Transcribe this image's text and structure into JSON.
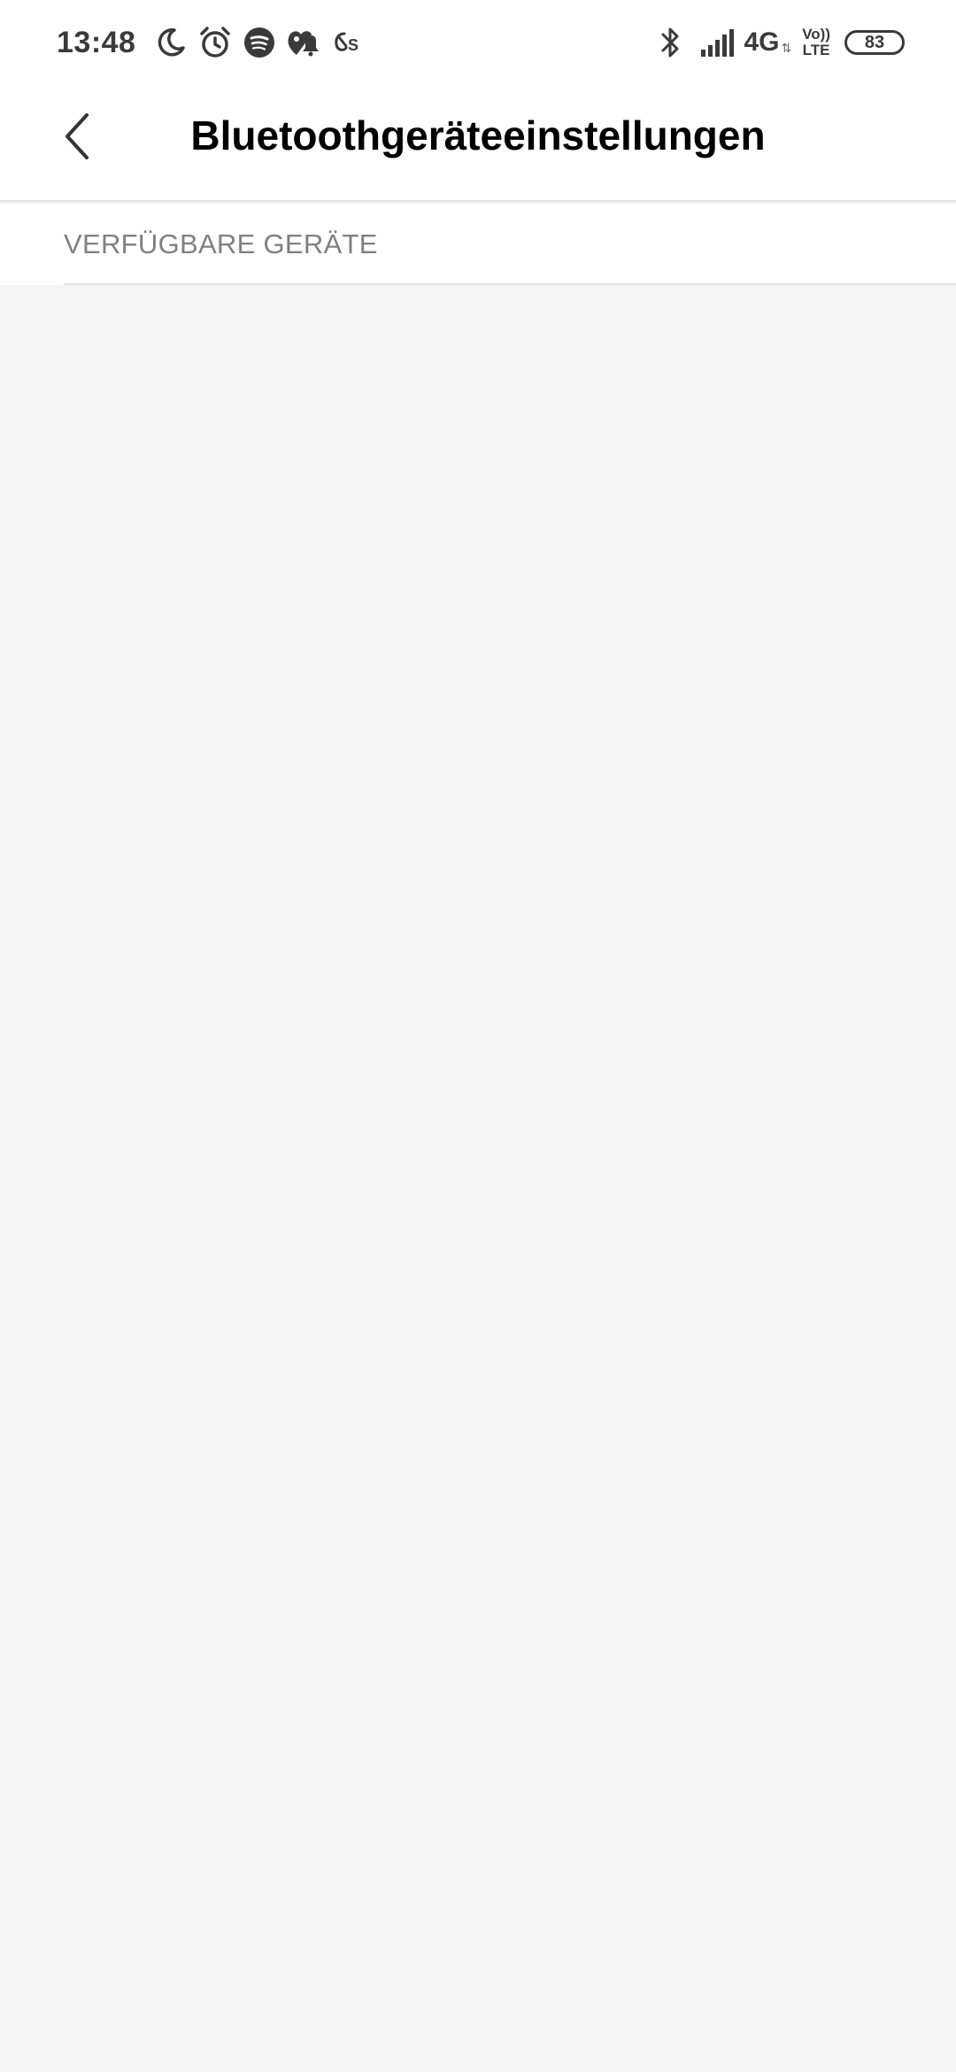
{
  "status_bar": {
    "time": "13:48",
    "network": "4G",
    "network_arrows": "⇅",
    "volte_top": "Vo))",
    "volte_bottom": "LTE",
    "battery": "83",
    "icons": [
      "moon-icon",
      "alarm-icon",
      "spotify-icon",
      "notification-icon",
      "app-icon",
      "bluetooth-icon",
      "signal-icon"
    ]
  },
  "header": {
    "title": "Bluetoothgeräteeinstellungen",
    "back_icon": "chevron-left-icon"
  },
  "section": {
    "label": "VERFÜGBARE GERÄTE"
  },
  "colors": {
    "background": "#f5f5f5",
    "surface": "#ffffff",
    "title": "#000000",
    "section_label": "#808080",
    "divider": "#e2e2e2",
    "status_icons": "#3a3a3a"
  }
}
